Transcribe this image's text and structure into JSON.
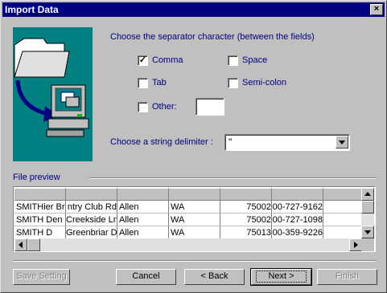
{
  "window": {
    "title": "Import Data",
    "close_glyph": "×"
  },
  "separator": {
    "heading": "Choose the separator character (between the fields)",
    "options": [
      {
        "label": "Comma",
        "checked": true
      },
      {
        "label": "Space",
        "checked": false
      },
      {
        "label": "Tab",
        "checked": false
      },
      {
        "label": "Semi-colon",
        "checked": false
      },
      {
        "label": "Other:",
        "checked": false
      }
    ],
    "other_value": ""
  },
  "delimiter": {
    "label": "Choose a string delimiter :",
    "value": "\""
  },
  "preview": {
    "label": "File preview",
    "headers": [
      "",
      "",
      "",
      "",
      "",
      "",
      ""
    ],
    "rows": [
      [
        "SMITHier Br",
        "ntry Club Rd",
        "Allen",
        "WA",
        "75002",
        "00-727-9162",
        ""
      ],
      [
        "SMITH Den",
        "Creekside Ln",
        "Allen",
        "WA",
        "75002",
        "00-727-1098",
        ""
      ],
      [
        "SMITH D",
        "Greenbriar Dr",
        "Allen",
        "WA",
        "75013",
        "00-359-9226",
        ""
      ]
    ]
  },
  "buttons": {
    "save_setting": "Save Setting",
    "cancel": "Cancel",
    "back": "< Back",
    "next": "Next >",
    "finish": "Finish"
  },
  "colors": {
    "title_bar": "#000080",
    "illustration_bg": "#008080",
    "label_text": "#000080",
    "face": "#c0c0c0"
  }
}
